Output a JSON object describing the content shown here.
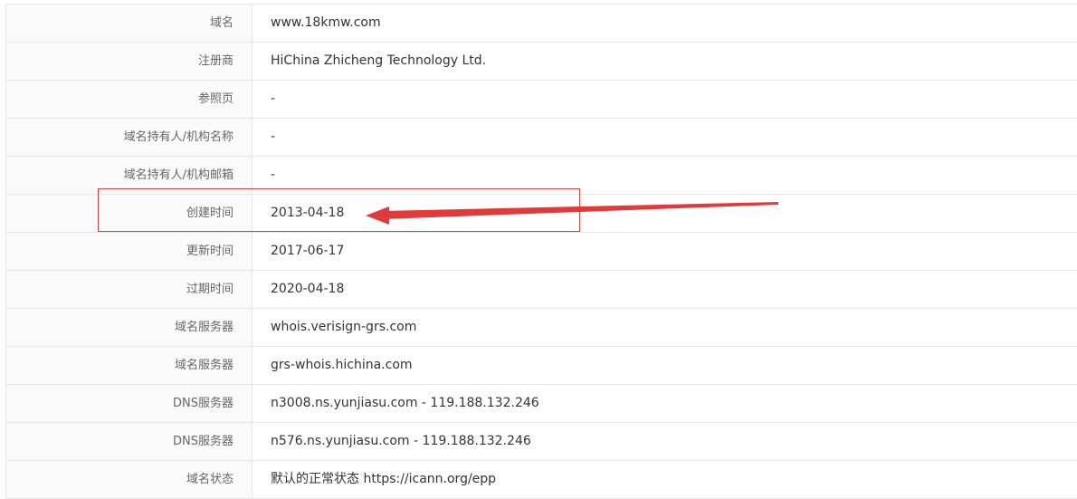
{
  "whois": {
    "rows": [
      {
        "label": "域名",
        "value": "www.18kmw.com"
      },
      {
        "label": "注册商",
        "value": "HiChina Zhicheng Technology Ltd."
      },
      {
        "label": "参照页",
        "value": "-"
      },
      {
        "label": "域名持有人/机构名称",
        "value": "-"
      },
      {
        "label": "域名持有人/机构邮箱",
        "value": "-"
      },
      {
        "label": "创建时间",
        "value": "2013-04-18"
      },
      {
        "label": "更新时间",
        "value": "2017-06-17"
      },
      {
        "label": "过期时间",
        "value": "2020-04-18"
      },
      {
        "label": "域名服务器",
        "value": "whois.verisign-grs.com"
      },
      {
        "label": "域名服务器",
        "value": "grs-whois.hichina.com"
      },
      {
        "label": "DNS服务器",
        "value": "n3008.ns.yunjiasu.com - 119.188.132.246"
      },
      {
        "label": "DNS服务器",
        "value": "n576.ns.yunjiasu.com - 119.188.132.246"
      },
      {
        "label": "域名状态",
        "value": "默认的正常状态 https://icann.org/epp"
      }
    ]
  },
  "annotation": {
    "highlight_color": "#e23a3a",
    "arrow_color": "#e23a3a"
  }
}
